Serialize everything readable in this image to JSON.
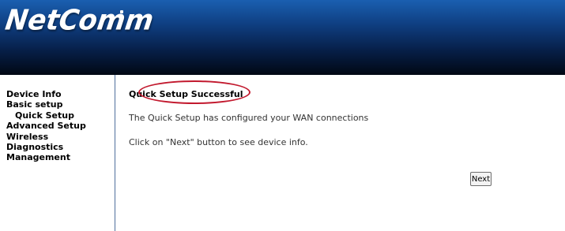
{
  "header": {
    "logo_text": "NetComm"
  },
  "sidebar": {
    "items": [
      {
        "label": "Device Info",
        "sub": false
      },
      {
        "label": "Basic setup",
        "sub": false
      },
      {
        "label": "Quick Setup",
        "sub": true
      },
      {
        "label": "Advanced Setup",
        "sub": false
      },
      {
        "label": "Wireless",
        "sub": false
      },
      {
        "label": "Diagnostics",
        "sub": false
      },
      {
        "label": "Management",
        "sub": false
      }
    ]
  },
  "main": {
    "title": "Quick Setup Successful",
    "message_1": "The Quick Setup has configured your WAN connections",
    "message_2": "Click on \"Next\" button to see device info.",
    "next_label": "Next"
  },
  "colors": {
    "header_top": "#1a5fb0",
    "header_bottom": "#010814",
    "annotation_circle": "#c2192e",
    "sidebar_divider": "#4f6f9d"
  }
}
